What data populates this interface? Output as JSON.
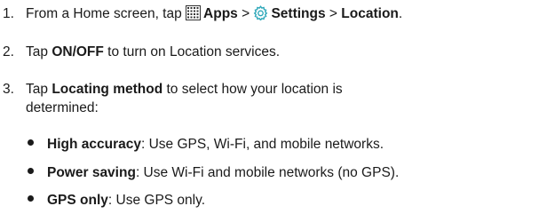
{
  "steps": [
    {
      "number": "1.",
      "prefix": "From a Home screen, tap ",
      "apps_icon": "apps-grid-icon",
      "apps_label": "Apps",
      "sep1": " > ",
      "settings_icon": "settings-gear-icon",
      "settings_label": "Settings",
      "sep2": " > ",
      "location_label": "Location",
      "suffix": "."
    },
    {
      "number": "2.",
      "prefix": "Tap ",
      "bold": "ON/OFF",
      "suffix": " to turn on Location services."
    },
    {
      "number": "3.",
      "prefix": "Tap ",
      "bold": "Locating method",
      "suffix": " to select how your location is",
      "continuation": "determined:"
    }
  ],
  "options": [
    {
      "name": "High accuracy",
      "desc": ": Use GPS, Wi-Fi, and mobile networks."
    },
    {
      "name": "Power saving",
      "desc": ": Use Wi-Fi and mobile networks (no GPS)."
    },
    {
      "name": "GPS only",
      "desc": ": Use GPS only."
    }
  ],
  "colors": {
    "text": "#1a1a1a",
    "settings_icon_teal": "#2aa6b8"
  }
}
